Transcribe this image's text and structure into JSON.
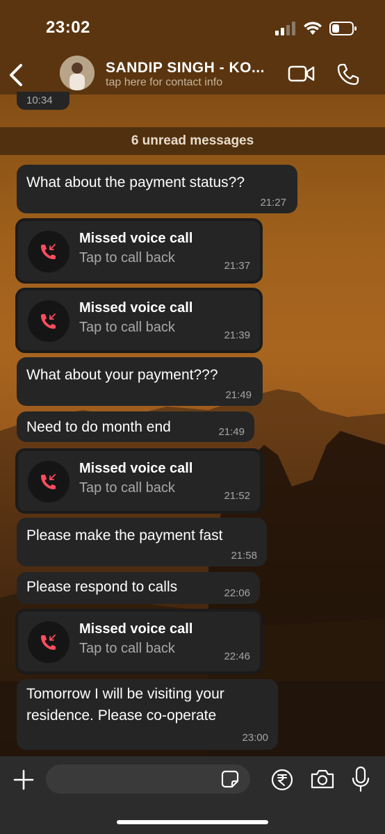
{
  "status_bar": {
    "time": "23:02"
  },
  "header": {
    "contact_name": "SANDIP SINGH - KO...",
    "contact_subtitle": "tap here for contact info"
  },
  "previous_message_time": "10:34",
  "unread_banner": "6 unread messages",
  "messages": [
    {
      "type": "text",
      "text": "What about the payment status??",
      "time": "21:27"
    },
    {
      "type": "call",
      "title": "Missed voice call",
      "subtitle": "Tap to call back",
      "time": "21:37"
    },
    {
      "type": "call",
      "title": "Missed voice call",
      "subtitle": "Tap to call back",
      "time": "21:39"
    },
    {
      "type": "text",
      "text": "What about your payment???",
      "time": "21:49"
    },
    {
      "type": "text",
      "text": "Need to do month end",
      "time": "21:49"
    },
    {
      "type": "call",
      "title": "Missed voice call",
      "subtitle": "Tap to call back",
      "time": "21:52"
    },
    {
      "type": "text",
      "text": "Please make the payment fast",
      "time": "21:58"
    },
    {
      "type": "text",
      "text": "Please respond to calls",
      "time": "22:06"
    },
    {
      "type": "call",
      "title": "Missed voice call",
      "subtitle": "Tap to call back",
      "time": "22:46"
    },
    {
      "type": "text",
      "text_lines": [
        "Tomorrow I will be visiting your",
        "residence. Please co-operate"
      ],
      "time": "23:00"
    }
  ],
  "input": {
    "placeholder": ""
  },
  "colors": {
    "bubble": "#252525",
    "missed_call_red": "#ff4d5e",
    "header": "#5a3510"
  }
}
